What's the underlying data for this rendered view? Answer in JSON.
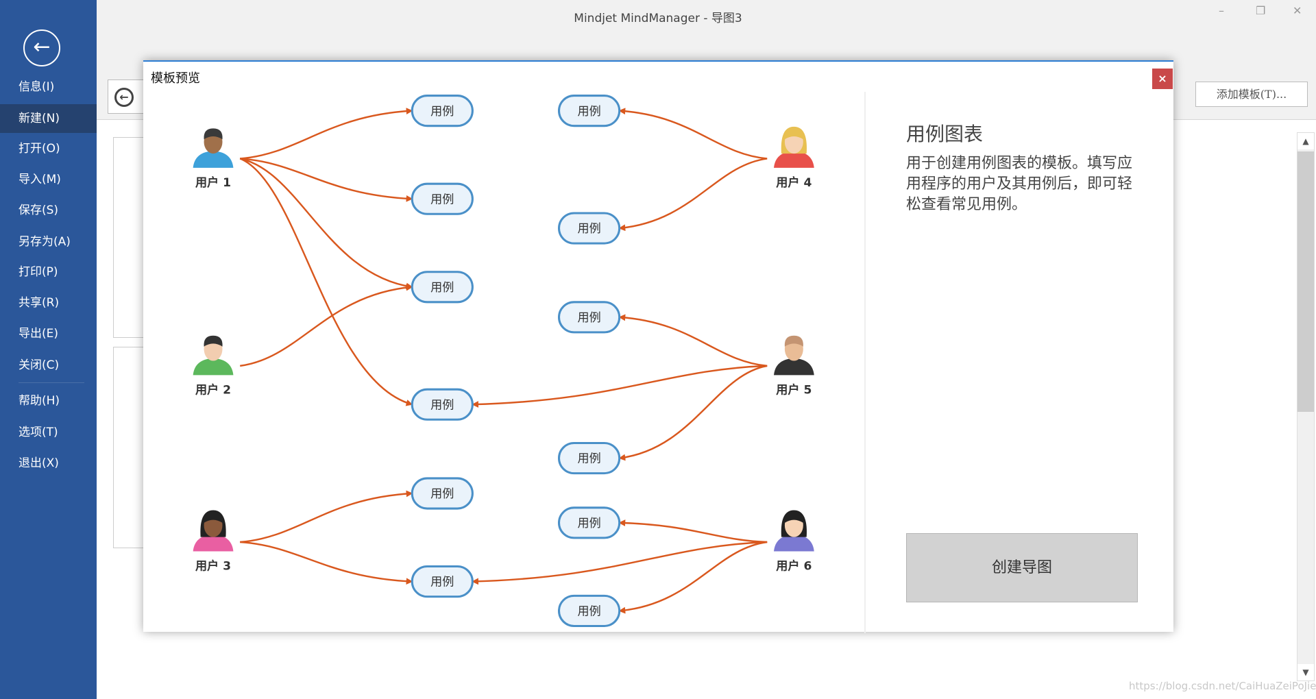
{
  "app_title": "Mindjet MindManager - 导图3",
  "window_controls": {
    "minimize": "–",
    "restore": "❐",
    "close": "✕"
  },
  "sidebar": {
    "back_icon": "←",
    "items": [
      {
        "label": "信息(I)"
      },
      {
        "label": "新建(N)",
        "selected": true
      },
      {
        "label": "打开(O)"
      },
      {
        "label": "导入(M)"
      },
      {
        "label": "保存(S)"
      },
      {
        "label": "另存为(A)"
      },
      {
        "label": "打印(P)"
      },
      {
        "label": "共享(R)"
      },
      {
        "label": "导出(E)"
      },
      {
        "label": "关闭(C)"
      },
      {
        "label": "帮助(H)"
      },
      {
        "label": "选项(T)"
      },
      {
        "label": "退出(X)"
      }
    ]
  },
  "toolbar": {
    "add_template": "添加模板(T)..."
  },
  "watermark": "https://blog.csdn.net/CaiHuaZeiPoJie",
  "dialog": {
    "title": "模板预览",
    "close": "×",
    "template_name": "用例图表",
    "description": "用于创建用例图表的模板。填写应用程序的用户及其用例后，即可轻松查看常见用例。",
    "create_button": "创建导图",
    "diagram": {
      "edge_color": "#d9581e",
      "bubble_fill": "#eaf3fb",
      "bubble_stroke": "#4a90c8",
      "users": [
        {
          "label": "用户 1",
          "skin": "#a0704a",
          "hair": "#3a3a3a",
          "shirt": "#3da1da"
        },
        {
          "label": "用户 2",
          "skin": "#f2cdb0",
          "hair": "#333333",
          "shirt": "#5cb85c"
        },
        {
          "label": "用户 3",
          "skin": "#8b5a3c",
          "hair": "#222222",
          "shirt": "#e95fa2"
        },
        {
          "label": "用户 4",
          "skin": "#f6d3b5",
          "hair": "#e8c052",
          "shirt": "#e8504a"
        },
        {
          "label": "用户 5",
          "skin": "#e9bc96",
          "hair": "#c49472",
          "shirt": "#333333"
        },
        {
          "label": "用户 6",
          "skin": "#f6d3b5",
          "hair": "#222222",
          "shirt": "#7b79d2"
        }
      ],
      "use_cases": [
        "用例",
        "用例",
        "用例",
        "用例",
        "用例",
        "用例",
        "用例",
        "用例",
        "用例",
        "用例",
        "用例",
        "用例"
      ],
      "edges": [
        [
          0,
          0
        ],
        [
          0,
          1
        ],
        [
          0,
          2
        ],
        [
          0,
          3
        ],
        [
          1,
          2
        ],
        [
          2,
          4
        ],
        [
          2,
          5
        ],
        [
          3,
          6
        ],
        [
          3,
          7
        ],
        [
          4,
          8
        ],
        [
          4,
          3
        ],
        [
          4,
          9
        ],
        [
          5,
          10
        ],
        [
          5,
          5
        ],
        [
          5,
          11
        ]
      ]
    }
  }
}
